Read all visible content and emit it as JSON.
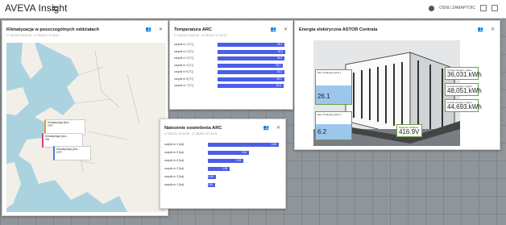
{
  "app": {
    "title": "AVEVA Insight",
    "top_right_label": "OSNU ZAMAPTOIC"
  },
  "icons": {
    "people": "people-icon",
    "close": "close-icon",
    "settings": "gear-icon",
    "check": "check-icon"
  },
  "panels": {
    "map": {
      "title": "Klimatyzacja w poszczególnych oddziałach",
      "subtitle": "27.08.2021 09:40:49 - 27.08.2021 07:40:04",
      "popups": [
        {
          "title": "Klimatyzacja [Ast...",
          "line1": "OFF",
          "line2": "Uzmiana"
        },
        {
          "title": "Klimatyzacja [Ast...",
          "line1": "ON",
          "line2": "Uzmiana"
        },
        {
          "title": "Klimatyzacja [Ast...",
          "line1": "OFF",
          "line2": "Uzmiana"
        }
      ]
    },
    "temp": {
      "title": "Temperatura ARC",
      "subtitle": "27.08.2021 09:40:49 - 27.08.2021 07:40:04"
    },
    "light": {
      "title": "Natezenie oswietlenia ARC",
      "subtitle": "27.08.2021 09:40:49 - 27.08.2021 07:40:04"
    },
    "energy": {
      "title": "Energia elektryczna ASTOR Centrala",
      "boxes": [
        {
          "title": "Moc chwilowa piętra 1",
          "value": "26.1"
        },
        {
          "title": "Moc chwilowa piętra 2",
          "value": "6.2"
        },
        {
          "title": "Licznik energii 1. piętro",
          "value": "36,031.",
          "unit": "kWh"
        },
        {
          "title": "Licznik energii 2. piętro",
          "value": "48,051.",
          "unit": "kWh"
        },
        {
          "title": "Licznik energii 3. piętro",
          "value": "44,693.",
          "unit": "kWh"
        },
        {
          "title": "Napięcie zasilania",
          "value": "416.9V"
        }
      ]
    }
  },
  "chart_data": [
    {
      "type": "bar",
      "title": "Temperatura ARC",
      "categories": [
        "czujnik nr 1 [°C]",
        "czujnik nr 2 [°C]",
        "czujnik nr 3 [°C]",
        "czujnik nr 4 [°C]",
        "czujnik nr 5 [°C]",
        "czujnik nr 6 [°C]",
        "czujnik nr 7 [°C]"
      ],
      "values": [
        26.3,
        26.5,
        26.2,
        25.7,
        26.2,
        26.1,
        25.8
      ],
      "labels": [
        "26.3",
        "26.5",
        "26.2",
        "25.7",
        "26.2",
        "26.1",
        "25.8"
      ]
    },
    {
      "type": "bar",
      "title": "Natezenie oswietlenia ARC",
      "categories": [
        "czujnik nr 4 [lux]",
        "czujnik nr 5 [lux]",
        "czujnik nr 6 [lux]",
        "czujnik nr 2 [lux]",
        "czujnik nr 3 [lux]",
        "czujnik nr 1 [lux]"
      ],
      "values": [
        5.86,
        3.4,
        2.94,
        1.82,
        0.65,
        0.58
      ],
      "labels": [
        "5.86",
        "3.40",
        "2.94",
        "1.82",
        "0.65",
        "0.58"
      ]
    }
  ]
}
